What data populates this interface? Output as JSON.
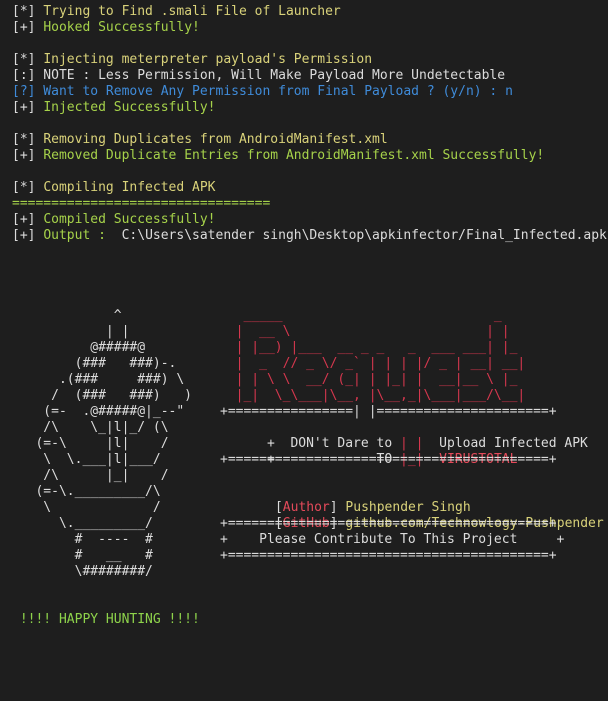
{
  "terminal": {
    "background": "#1e1e1e",
    "colors": {
      "white": "#dcdcdc",
      "yellow": "#d9d27a",
      "green": "#a6d24a",
      "blue": "#3f8bd9",
      "red": "#d5374e"
    },
    "lines": [
      [
        {
          "t": "[*] ",
          "c": "white"
        },
        {
          "t": "Trying to Find .smali File of Launcher",
          "c": "yellow"
        }
      ],
      [
        {
          "t": "[+] ",
          "c": "white"
        },
        {
          "t": "Hooked Successfully!",
          "c": "green"
        }
      ],
      [],
      [
        {
          "t": "[*] ",
          "c": "white"
        },
        {
          "t": "Injecting meterpreter payload's Permission",
          "c": "yellow"
        }
      ],
      [
        {
          "t": "[:] NOTE : Less Permission, Will Make Payload More Undetectable",
          "c": "white"
        }
      ],
      [
        {
          "t": "[?] Want to Remove Any Permission from Final Payload ? (y/n) : n",
          "c": "blue"
        }
      ],
      [
        {
          "t": "[+] ",
          "c": "white"
        },
        {
          "t": "Injected Successfully!",
          "c": "green"
        }
      ],
      [],
      [
        {
          "t": "[*] ",
          "c": "white"
        },
        {
          "t": "Removing Duplicates from AndroidManifest.xml",
          "c": "yellow"
        }
      ],
      [
        {
          "t": "[+] ",
          "c": "white"
        },
        {
          "t": "Removed Duplicate Entries from AndroidManifest.xml Successfully!",
          "c": "green"
        }
      ],
      [],
      [
        {
          "t": "[*] ",
          "c": "white"
        },
        {
          "t": "Compiling Infected APK",
          "c": "yellow"
        }
      ],
      [
        {
          "t": "=================================",
          "c": "green"
        }
      ],
      [
        {
          "t": "[+] ",
          "c": "white"
        },
        {
          "t": "Compiled Successfully!",
          "c": "green"
        }
      ],
      [
        {
          "t": "[+] ",
          "c": "white"
        },
        {
          "t": "Output :  ",
          "c": "green"
        },
        {
          "t": "C:\\Users\\satender singh\\Desktop\\apkinfector/Final_Infected.apk",
          "c": "white"
        }
      ]
    ]
  },
  "banner": {
    "bug_art": [
      "             ^",
      "            | |",
      "          @#####@",
      "        (###   ###)-.",
      "      .(###     ###) \\",
      "     /  (###   ###)   )",
      "    (=-  .@#####@|_--\"",
      "    /\\    \\_|l|_/ (\\",
      "   (=-\\     |l|    /",
      "    \\  \\.___|l|___/",
      "    /\\      |_|    /",
      "   (=-\\._________/\\",
      "    \\             /",
      "      \\._________/",
      "        #  ----  #",
      "        #   __   #",
      "        \\########/"
    ],
    "request_logo": [
      "   _____                           _",
      "  |  __ \\                         | |",
      "  | |__) |___  __ _ _   _  ___ ___| |_",
      "  |  _  // _ \\/ _` | | | |/ _ | __| __|",
      "  | | \\ \\  __/ (_| | |_| |  __|__ \\ |_",
      "  |_|  \\_\\___|\\__, |\\__,_|\\___|___/\\__|"
    ],
    "box_top": "+================| |======================+",
    "box_line1_left": "+  DON't Dare to ",
    "box_line1_right": "  Upload Infected APK   +",
    "box_line2_left": "+             TO ",
    "box_line2_right": "  VIRUSTOTAL            +",
    "box_pipe_open": "| |",
    "box_pipe_close": "|_|",
    "box_bottom": "+=========================================+",
    "author_label": "Author",
    "author_value": "Pushpender Singh",
    "github_label": "GitHub",
    "github_value": "github.com/Technowlogy-Pushpender",
    "contribute_top": "+=========================================+",
    "contribute_text": "+    Please Contribute To This Project     +",
    "contribute_bottom": "+=========================================+",
    "happy_hunting": " !!!! HAPPY HUNTING !!!!"
  }
}
